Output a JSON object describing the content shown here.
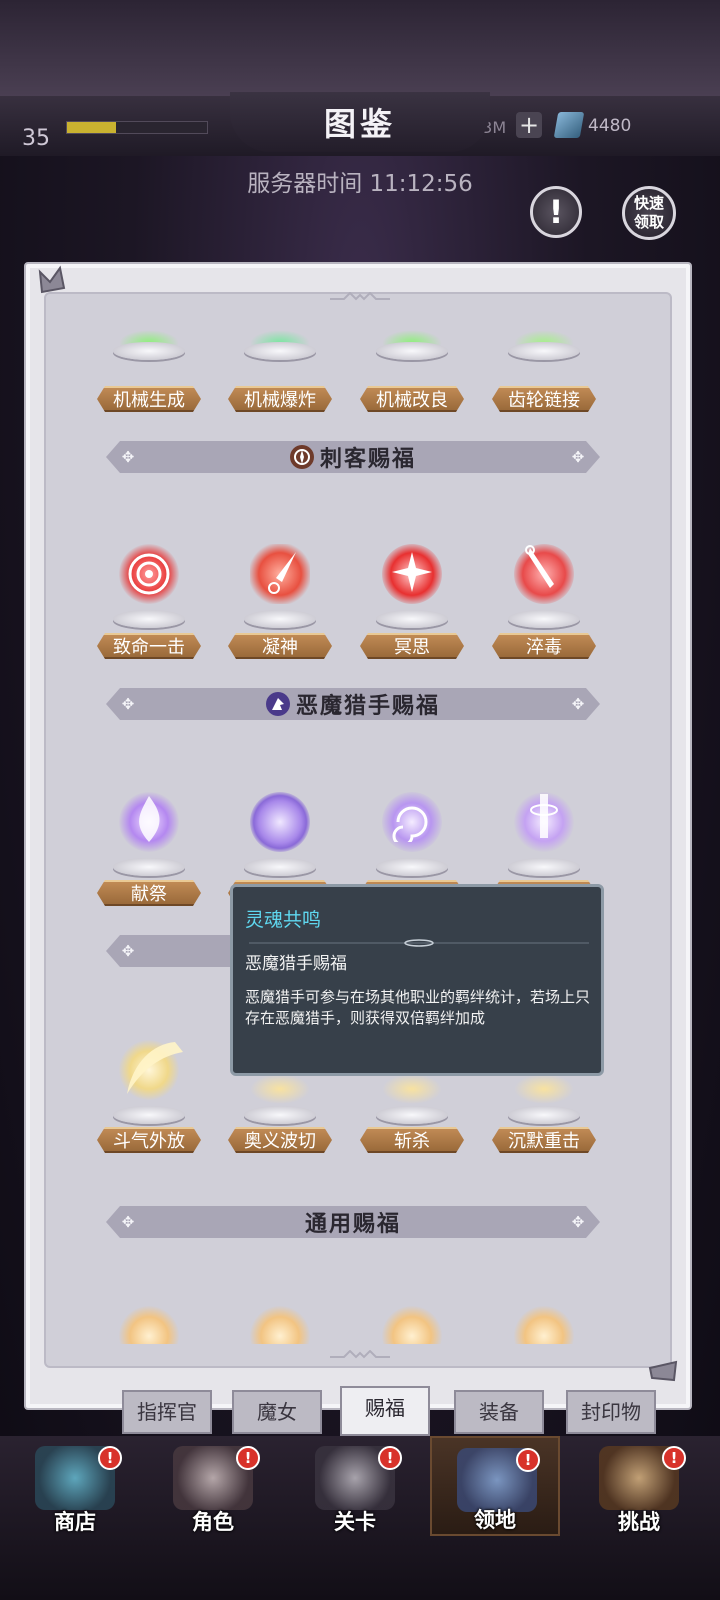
{
  "header": {
    "title": "图鉴",
    "level": "35",
    "xp_progress": 0.35,
    "currency_left": "3…3M",
    "gems": "4480",
    "server_time": "服务器时间 11:12:56",
    "quick_claim_label": "快速\n领取"
  },
  "sections": {
    "mech_skills": [
      "机械生成",
      "机械爆炸",
      "机械改良",
      "齿轮链接"
    ],
    "assassin": {
      "title": "刺客赐福",
      "skills": [
        "致命一击",
        "凝神",
        "冥思",
        "淬毒"
      ]
    },
    "demon_hunter": {
      "title": "恶魔猎手赐福",
      "skills": [
        "献祭",
        "",
        "",
        ""
      ]
    },
    "warrior_skills": [
      "斗气外放",
      "奥义波切",
      "斩杀",
      "沉默重击"
    ],
    "general": {
      "title": "通用赐福"
    }
  },
  "tooltip": {
    "title": "灵魂共鸣",
    "subtitle": "恶魔猎手赐福",
    "body": "恶魔猎手可参与在场其他职业的羁绊统计，若场上只存在恶魔猎手，则获得双倍羁绊加成"
  },
  "tabs": [
    "指挥官",
    "魔女",
    "赐福",
    "装备",
    "封印物"
  ],
  "active_tab": "赐福",
  "nav": [
    "商店",
    "角色",
    "关卡",
    "领地",
    "挑战"
  ],
  "active_nav": "领地",
  "colors": {
    "label_bg": "#b07a48",
    "tooltip_title": "#5fd8f0",
    "assassin_glow": "#e84040",
    "demon_glow": "#b48ae8",
    "warrior_glow": "#f0d48a"
  }
}
